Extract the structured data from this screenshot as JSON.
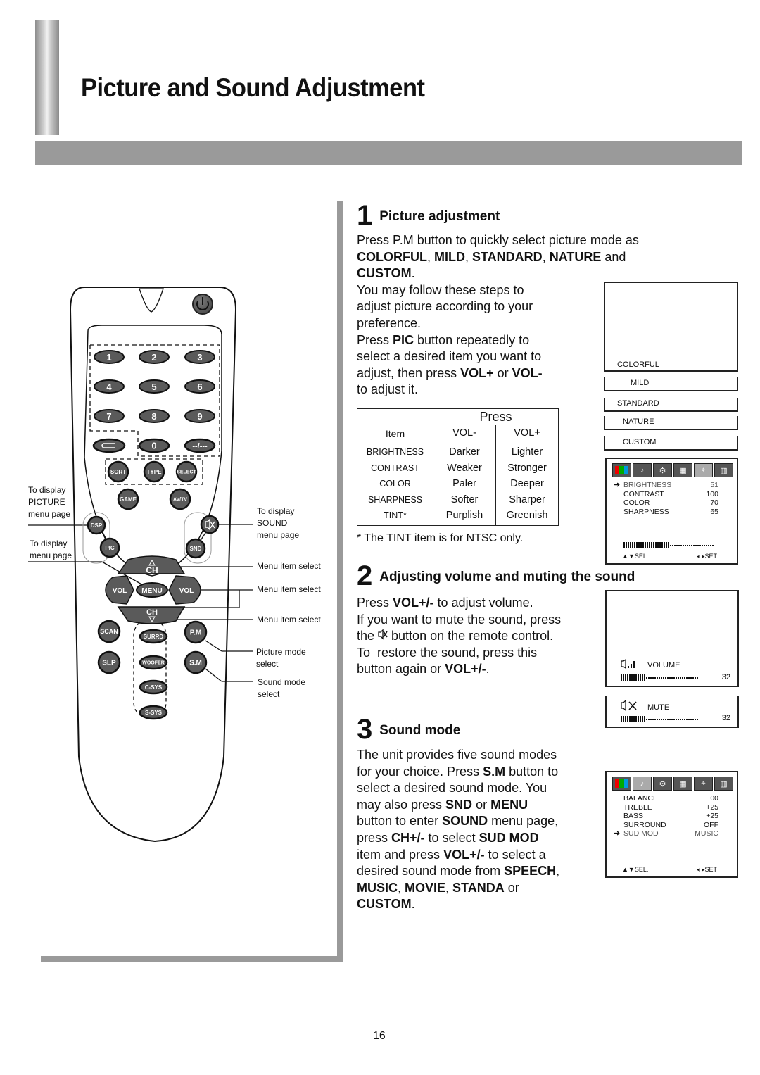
{
  "page": {
    "title": "Picture and Sound Adjustment",
    "page_number": "16"
  },
  "remote": {
    "digits": [
      "1",
      "2",
      "3",
      "4",
      "5",
      "6",
      "7",
      "8",
      "9"
    ],
    "zero": "0",
    "dash_key": "--/---",
    "row_small": [
      "SORT",
      "TYPE",
      "SELECT"
    ],
    "game": "GAME",
    "avtv": "AV/TV",
    "dsp": "DSP",
    "pic": "PIC",
    "snd": "SND",
    "ch_up": "CH",
    "ch_down": "CH",
    "vol_left": "VOL",
    "vol_right": "VOL",
    "menu": "MENU",
    "scan": "SCAN",
    "slp": "SLP",
    "surrd": "SURRD",
    "woofer": "WOOFER",
    "csys": "C-SYS",
    "ssys": "S-SYS",
    "pm": "P.M",
    "sm": "S.M",
    "labels": {
      "picture_menu": [
        "To display",
        "PICTURE",
        "menu page"
      ],
      "menu_page": [
        "To display",
        "menu page"
      ],
      "sound_menu": [
        "To display",
        "SOUND",
        "menu page"
      ],
      "menu_item_select_1": "Menu item select",
      "menu_item_select_2": "Menu item select",
      "menu_item_select_3": "Menu item select",
      "picture_mode": [
        "Picture mode",
        "select"
      ],
      "sound_mode": [
        "Sound mode",
        "select"
      ]
    }
  },
  "section1": {
    "number": "1",
    "heading": "Picture adjustment",
    "p1_a": "Press P.M button to quickly select picture mode as",
    "p1_modes": [
      "COLORFUL",
      "MILD",
      "STANDARD",
      "NATURE"
    ],
    "p1_and": "and",
    "p1_last": "CUSTOM",
    "p2": [
      "You may follow these steps to",
      "adjust picture according to your",
      "preference."
    ],
    "p3_a": "Press ",
    "p3_pic": "PIC",
    "p3_b": " button repeatedly to",
    "p3_c": "select a desired item you want to",
    "p3_d": "adjust, then press ",
    "p3_volp": "VOL+",
    "p3_or": " or ",
    "p3_volm": "VOL-",
    "p3_e": "to adjust it.",
    "table": {
      "press_header": "Press",
      "item_header": "Item",
      "volm_header": "VOL-",
      "volp_header": "VOL+",
      "rows": [
        {
          "item": "BRIGHTNESS",
          "volm": "Darker",
          "volp": "Lighter"
        },
        {
          "item": "CONTRAST",
          "volm": "Weaker",
          "volp": "Stronger"
        },
        {
          "item": "COLOR",
          "volm": "Paler",
          "volp": "Deeper"
        },
        {
          "item": "SHARPNESS",
          "volm": "Softer",
          "volp": "Sharper"
        },
        {
          "item": "TINT*",
          "volm": "Purplish",
          "volp": "Greenish"
        }
      ]
    },
    "tint_note": "* The TINT item is for NTSC only.",
    "mode_screen": {
      "current": "COLORFUL",
      "tabs": [
        "MILD",
        "STANDARD",
        "NATURE",
        "CUSTOM"
      ]
    },
    "picture_osd": {
      "rows": [
        {
          "label": "BRIGHTNESS",
          "value": "51",
          "selected": true
        },
        {
          "label": "CONTRAST",
          "value": "100",
          "selected": false
        },
        {
          "label": "COLOR",
          "value": "70",
          "selected": false
        },
        {
          "label": "SHARPNESS",
          "value": "65",
          "selected": false
        }
      ],
      "bar_level": 0.51,
      "sel_hint": "SEL.",
      "set_hint": "SET"
    }
  },
  "section2": {
    "number": "2",
    "heading": "Adjusting volume and muting the sound",
    "l1_a": "Press ",
    "l1_b": "VOL+/-",
    "l1_c": " to adjust volume.",
    "l2": "If you want to mute the sound, press",
    "l3_a": "the ",
    "l3_b": " button on the remote control.",
    "l4": "To  restore the sound, press this",
    "l5_a": "button again or ",
    "l5_b": "VOL+/-",
    "l5_c": ".",
    "volume_osd": {
      "label": "VOLUME",
      "value": "32",
      "level": 0.32
    },
    "mute_osd": {
      "label": "MUTE",
      "value": "32",
      "level": 0.32
    }
  },
  "section3": {
    "number": "3",
    "heading": "Sound mode",
    "lines": [
      [
        {
          "t": "The unit provides five sound modes"
        }
      ],
      [
        {
          "t": "for your choice. Press "
        },
        {
          "t": "S.M",
          "b": true
        },
        {
          "t": " button to"
        }
      ],
      [
        {
          "t": "select a desired sound mode. You"
        }
      ],
      [
        {
          "t": "may also press "
        },
        {
          "t": "SND",
          "b": true
        },
        {
          "t": " or "
        },
        {
          "t": "MENU",
          "b": true
        }
      ],
      [
        {
          "t": "button to enter "
        },
        {
          "t": "SOUND",
          "b": true
        },
        {
          "t": " menu page,"
        }
      ],
      [
        {
          "t": "press "
        },
        {
          "t": "CH+/-",
          "b": true
        },
        {
          "t": " to select "
        },
        {
          "t": "SUD MOD",
          "b": true
        }
      ],
      [
        {
          "t": "item and press "
        },
        {
          "t": "VOL+/-",
          "b": true
        },
        {
          "t": " to select a"
        }
      ],
      [
        {
          "t": "desired sound mode from "
        },
        {
          "t": "SPEECH",
          "b": true
        },
        {
          "t": ","
        }
      ],
      [
        {
          "t": "MUSIC",
          "b": true
        },
        {
          "t": ", "
        },
        {
          "t": "MOVIE",
          "b": true
        },
        {
          "t": ", "
        },
        {
          "t": "STANDA",
          "b": true
        },
        {
          "t": " or"
        }
      ],
      [
        {
          "t": "CUSTOM",
          "b": true
        },
        {
          "t": "."
        }
      ]
    ],
    "sound_osd": {
      "rows": [
        {
          "label": "BALANCE",
          "value": "00",
          "selected": false
        },
        {
          "label": "TREBLE",
          "value": "+25",
          "selected": false
        },
        {
          "label": "BASS",
          "value": "+25",
          "selected": false
        },
        {
          "label": "SURROUND",
          "value": "OFF",
          "selected": false
        },
        {
          "label": "SUD MOD",
          "value": "MUSIC",
          "selected": true
        }
      ],
      "sel_hint": "SEL.",
      "set_hint": "SET"
    }
  },
  "colors": {
    "frame_gray": "#9a9a9a",
    "button_gray": "#5a5a5a",
    "text": "#111111"
  }
}
